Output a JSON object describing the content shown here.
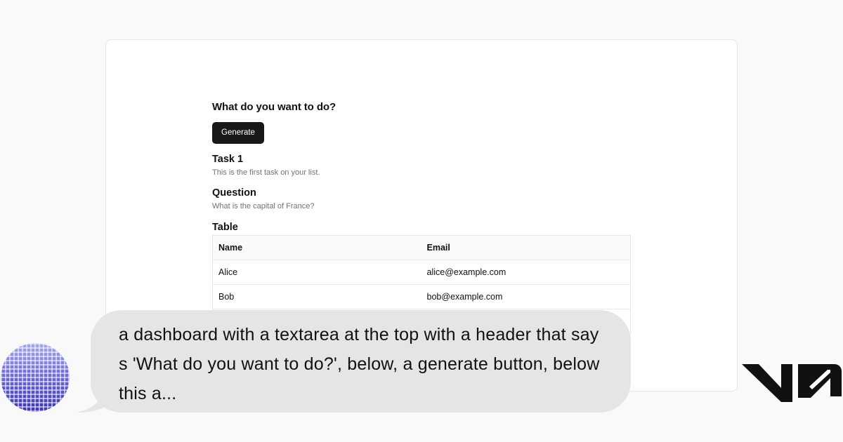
{
  "preview": {
    "heading": "What do you want to do?",
    "generate_label": "Generate",
    "task": {
      "title": "Task 1",
      "description": "This is the first task on your list."
    },
    "question": {
      "title": "Question",
      "description": "What is the capital of France?"
    },
    "table": {
      "title": "Table",
      "headers": [
        "Name",
        "Email"
      ],
      "rows": [
        [
          "Alice",
          "alice@example.com"
        ],
        [
          "Bob",
          "bob@example.com"
        ]
      ]
    }
  },
  "prompt": {
    "text": "a dashboard with a textarea at the top with a header that says 'What do you want to do?', below, a generate button, below this a..."
  },
  "colors": {
    "button_bg": "#18181b",
    "bubble_bg": "#e5e5e7",
    "avatar_accent": "#3c33b8"
  },
  "icons": {
    "avatar": "pixel-gradient-avatar",
    "logo": "v0-logo"
  }
}
